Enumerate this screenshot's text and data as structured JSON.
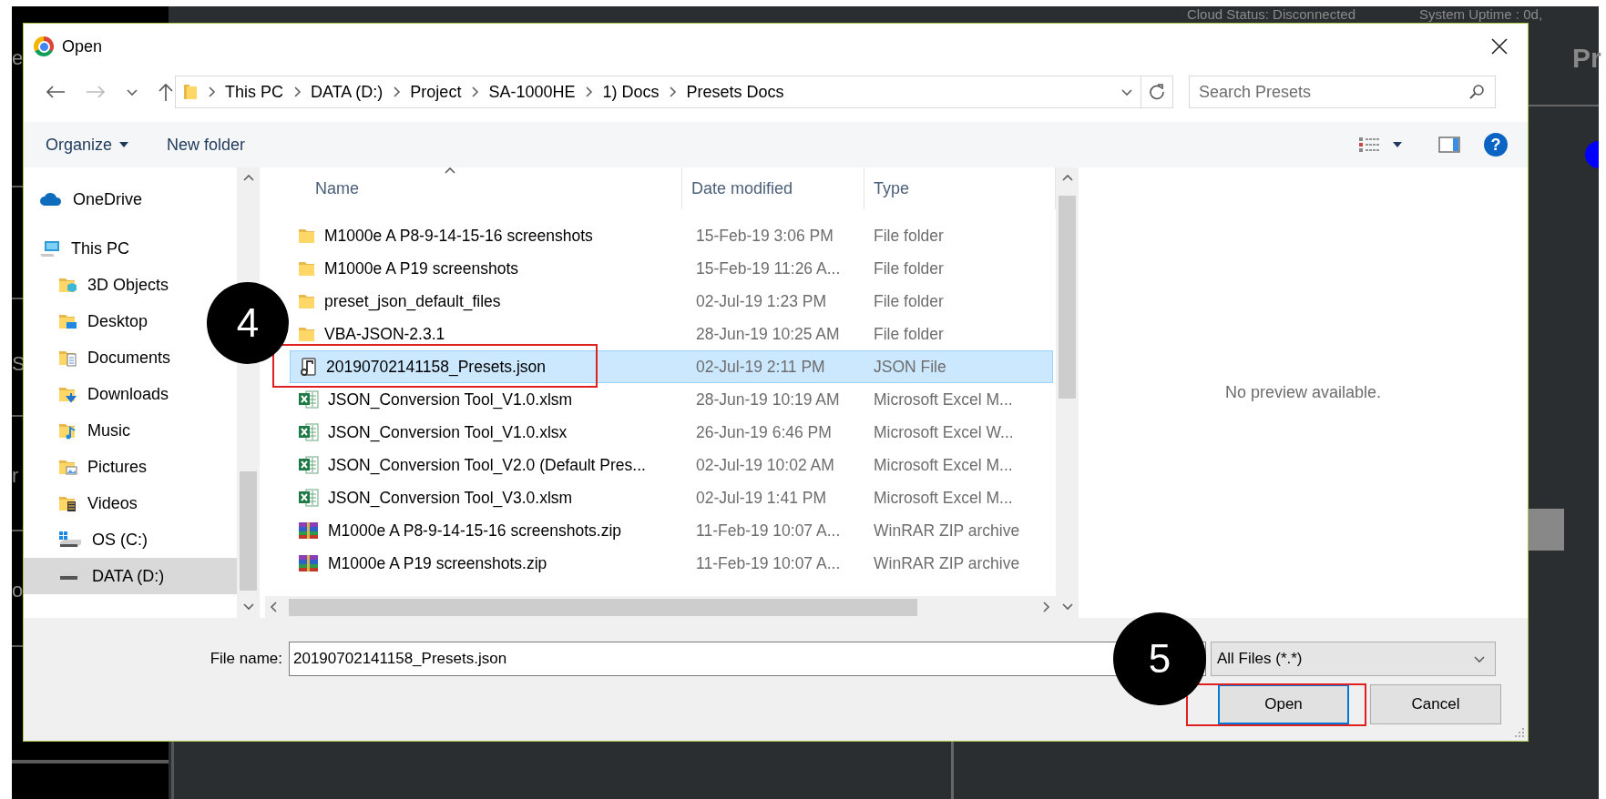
{
  "background_app": {
    "sidebar_fragments": [
      "e",
      "S",
      "r",
      "o"
    ],
    "status_items": [
      "Cloud Status: Disconnected",
      "System Uptime : 0d,"
    ],
    "heading": "Pr"
  },
  "dialog": {
    "title": "Open",
    "address": [
      "This PC",
      "DATA (D:)",
      "Project",
      "SA-1000HE",
      "1) Docs",
      "Presets Docs"
    ],
    "search": {
      "placeholder": "Search Presets"
    },
    "toolbar": {
      "organize": "Organize",
      "new_folder": "New folder",
      "help": "?"
    },
    "nav_items": [
      {
        "label": "OneDrive",
        "kind": "cloud",
        "selected": false
      },
      {
        "label": "This PC",
        "kind": "pc",
        "selected": false,
        "children": [
          {
            "label": "3D Objects",
            "kind": "objects",
            "selected": false
          },
          {
            "label": "Desktop",
            "kind": "desktop",
            "selected": false
          },
          {
            "label": "Documents",
            "kind": "documents",
            "selected": false
          },
          {
            "label": "Downloads",
            "kind": "downloads",
            "selected": false
          },
          {
            "label": "Music",
            "kind": "music",
            "selected": false
          },
          {
            "label": "Pictures",
            "kind": "pictures",
            "selected": false
          },
          {
            "label": "Videos",
            "kind": "videos",
            "selected": false
          },
          {
            "label": "OS (C:)",
            "kind": "osdrive",
            "selected": false
          },
          {
            "label": "DATA (D:)",
            "kind": "drive",
            "selected": true
          }
        ]
      }
    ],
    "columns": [
      "Name",
      "Date modified",
      "Type"
    ],
    "rows": [
      {
        "name": "M1000e A P8-9-14-15-16 screenshots",
        "date": "15-Feb-19 3:06 PM",
        "type": "File folder",
        "kind": "folder",
        "selected": false
      },
      {
        "name": "M1000e A P19 screenshots",
        "date": "15-Feb-19 11:26 A...",
        "type": "File folder",
        "kind": "folder",
        "selected": false
      },
      {
        "name": "preset_json_default_files",
        "date": "02-Jul-19 1:23 PM",
        "type": "File folder",
        "kind": "folder",
        "selected": false
      },
      {
        "name": "VBA-JSON-2.3.1",
        "date": "28-Jun-19 10:25 AM",
        "type": "File folder",
        "kind": "folder",
        "selected": false
      },
      {
        "name": "20190702141158_Presets.json",
        "date": "02-Jul-19 2:11 PM",
        "type": "JSON File",
        "kind": "json",
        "selected": true
      },
      {
        "name": "JSON_Conversion Tool_V1.0.xlsm",
        "date": "28-Jun-19 10:19 AM",
        "type": "Microsoft Excel M...",
        "kind": "excel",
        "selected": false
      },
      {
        "name": "JSON_Conversion Tool_V1.0.xlsx",
        "date": "26-Jun-19 6:46 PM",
        "type": "Microsoft Excel W...",
        "kind": "excel",
        "selected": false
      },
      {
        "name": "JSON_Conversion Tool_V2.0 (Default Pres...",
        "date": "02-Jul-19 10:02 AM",
        "type": "Microsoft Excel M...",
        "kind": "excel",
        "selected": false
      },
      {
        "name": "JSON_Conversion Tool_V3.0.xlsm",
        "date": "02-Jul-19 1:41 PM",
        "type": "Microsoft Excel M...",
        "kind": "excel",
        "selected": false
      },
      {
        "name": "M1000e A P8-9-14-15-16 screenshots.zip",
        "date": "11-Feb-19 10:07 A...",
        "type": "WinRAR ZIP archive",
        "kind": "zip",
        "selected": false
      },
      {
        "name": "M1000e A P19 screenshots.zip",
        "date": "11-Feb-19 10:07 A...",
        "type": "WinRAR ZIP archive",
        "kind": "zip",
        "selected": false
      }
    ],
    "preview_text": "No preview available.",
    "file_name_label": "File name:",
    "file_name": "20190702141158_Presets.json",
    "filter": "All Files (*.*)",
    "buttons": [
      {
        "label": "Open",
        "kind": "primary"
      },
      {
        "label": "Cancel",
        "kind": "secondary"
      }
    ]
  },
  "annotations": [
    {
      "number": "4"
    },
    {
      "number": "5"
    }
  ]
}
